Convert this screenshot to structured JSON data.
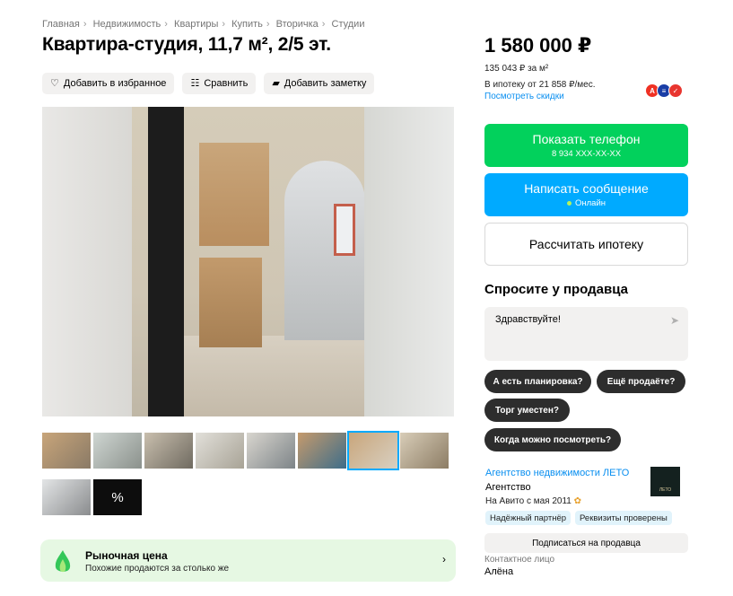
{
  "breadcrumb": [
    "Главная",
    "Недвижимость",
    "Квартиры",
    "Купить",
    "Вторичка",
    "Студии"
  ],
  "breadcrumb_sep": "›",
  "title": "Квартира-студия, 11,7 м², 2/5 эт.",
  "actions": {
    "favorite": "Добавить в избранное",
    "compare": "Сравнить",
    "note": "Добавить заметку"
  },
  "thumbnails": {
    "count_shown": 10,
    "selected_index": 6,
    "more_icon": "%"
  },
  "market": {
    "title": "Рыночная цена",
    "subtitle": "Похожие продаются за столько же",
    "chevron": "›"
  },
  "price": {
    "total": "1 580 000 ₽",
    "per_m2": "135 043 ₽ за м²",
    "mortgage": "В ипотеку от 21 858 ₽/мес.",
    "discounts_link": "Посмотреть скидки"
  },
  "banks": [
    {
      "icon": "alfa-bank-icon",
      "letter": "А",
      "color": "#ef3124"
    },
    {
      "icon": "vtb-bank-icon",
      "letter": "≡",
      "color": "#1a3ea6"
    },
    {
      "icon": "sovcom-bank-icon",
      "letter": "✓",
      "color": "#e8352f"
    }
  ],
  "buttons": {
    "phone_label": "Показать телефон",
    "phone_number": "8 934 XXX-XX-XX",
    "message_label": "Написать сообщение",
    "online_status": "Онлайн",
    "mortgage_calc": "Рассчитать ипотеку"
  },
  "ask": {
    "title": "Спросите у продавца",
    "input_value": "Здравствуйте!",
    "chips": [
      "А есть планировка?",
      "Ещё продаёте?",
      "Торг уместен?",
      "Когда можно посмотреть?"
    ]
  },
  "seller": {
    "name": "Агентство недвижимости ЛЕТО",
    "type": "Агентство",
    "since": "На Авито с мая 2011",
    "badges": [
      "Надёжный партнёр",
      "Реквизиты проверены"
    ],
    "logo_text": "ЛЕТО",
    "subscribe": "Подписаться на продавца",
    "contact_label": "Контактное лицо",
    "contact_name": "Алёна"
  },
  "colors": {
    "green": "#02d15c",
    "blue": "#00aaff",
    "link": "#0a8ff0",
    "market_bg": "#e6f8e3"
  }
}
